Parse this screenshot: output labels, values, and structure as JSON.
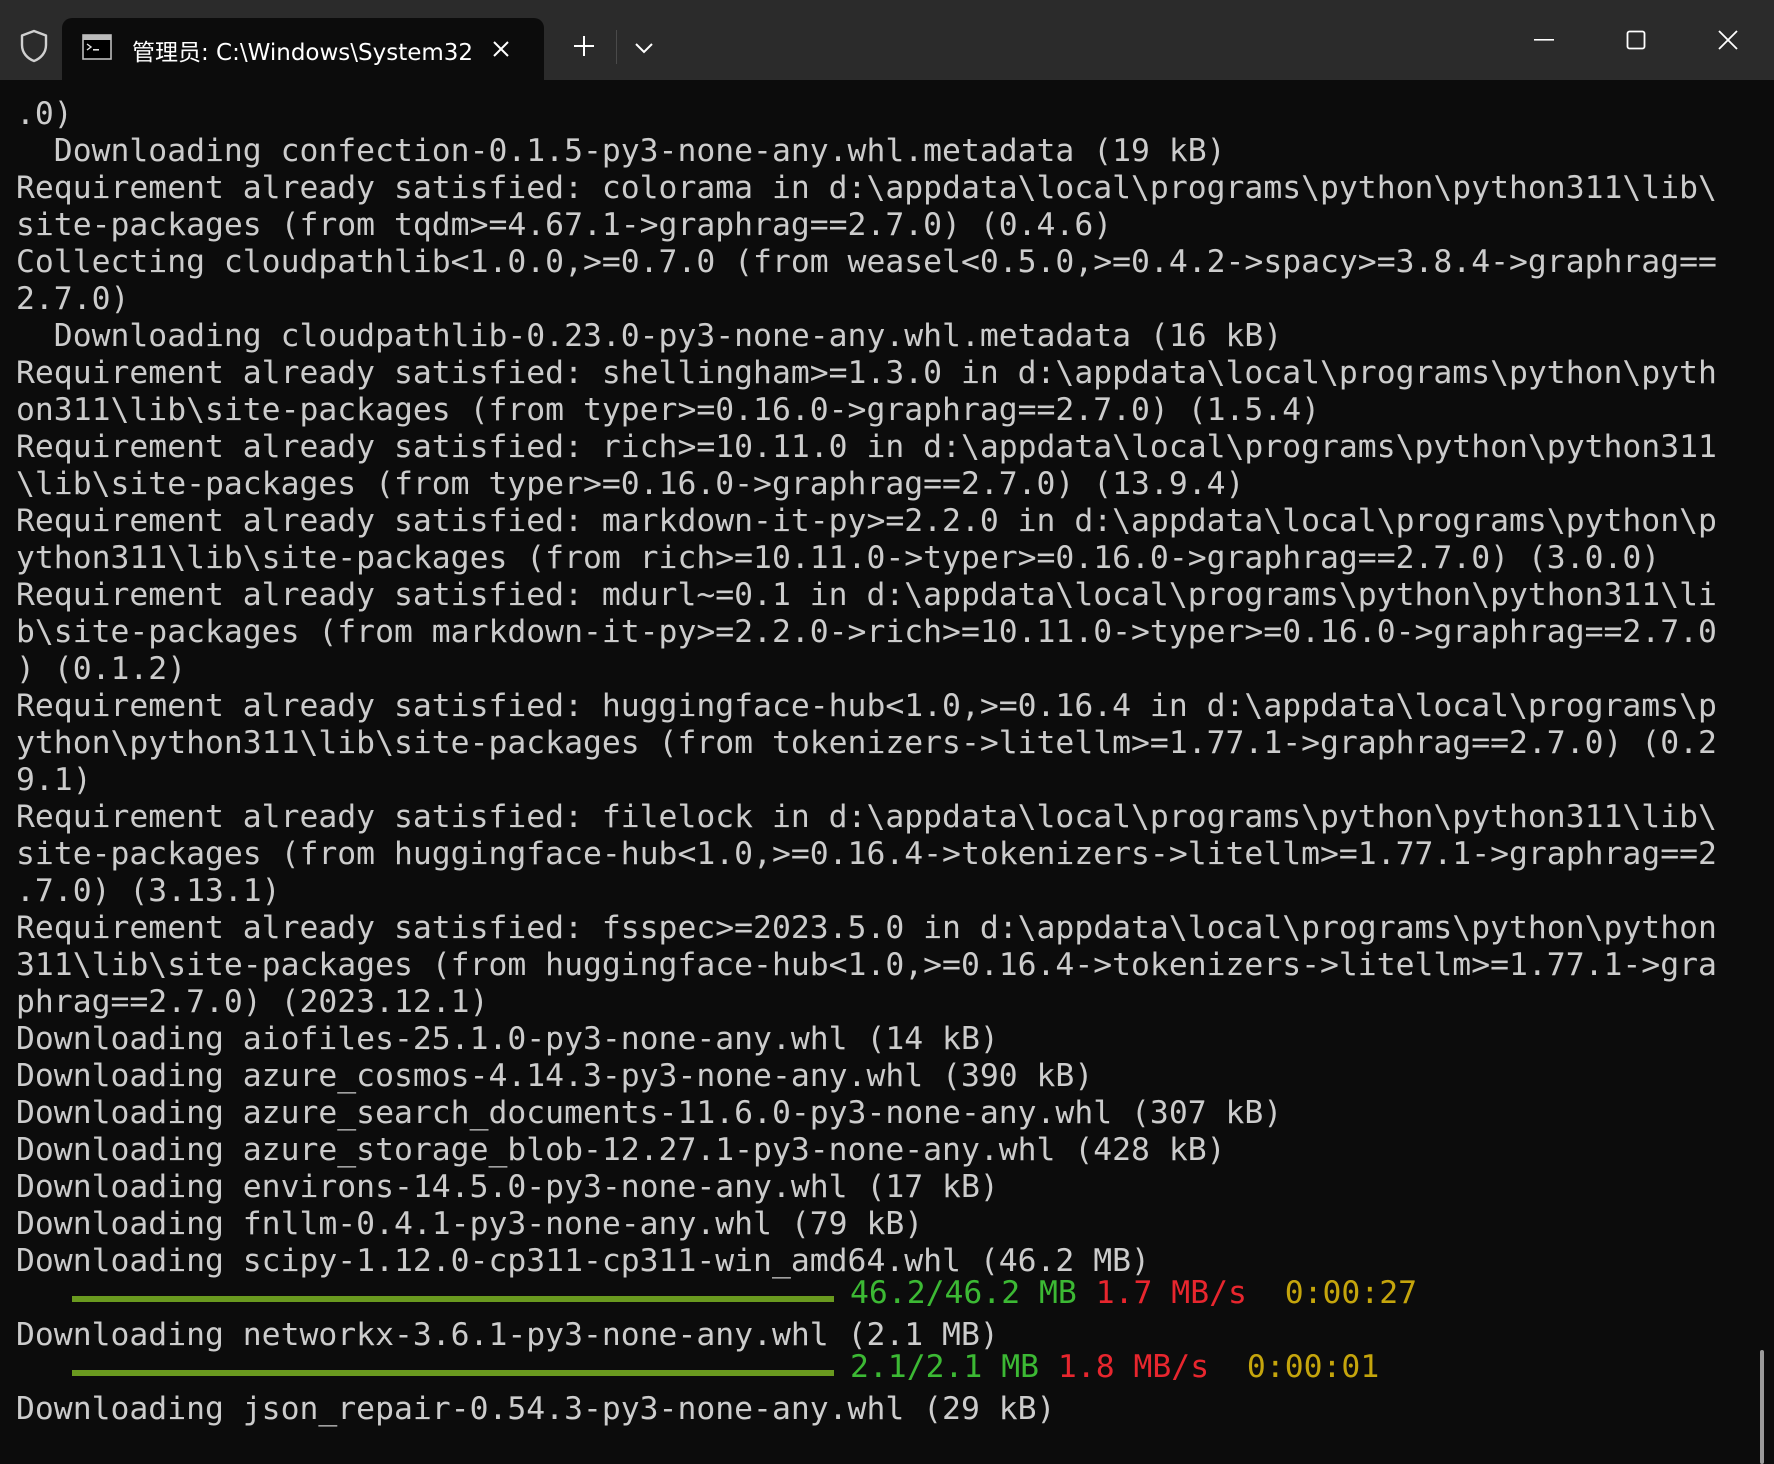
{
  "window": {
    "tab_title": "管理员: C:\\Windows\\System32",
    "icons": {
      "shield": "shield-icon",
      "terminal": "terminal-icon",
      "tab_close": "close-icon",
      "new_tab": "plus-icon",
      "dropdown": "chevron-down-icon",
      "minimize": "minimize-icon",
      "maximize": "maximize-icon",
      "close": "close-icon"
    }
  },
  "colors": {
    "background": "#0c0c0c",
    "titlebar": "#2b2b2b",
    "text": "#cccccc",
    "progress_bar": "#6a9a1f",
    "green": "#3cb934",
    "red": "#e8262e",
    "yellow": "#c5a50c"
  },
  "terminal": {
    "lines": [
      ".0)",
      "  Downloading confection-0.1.5-py3-none-any.whl.metadata (19 kB)",
      "Requirement already satisfied: colorama in d:\\appdata\\local\\programs\\python\\python311\\lib\\",
      "site-packages (from tqdm>=4.67.1->graphrag==2.7.0) (0.4.6)",
      "Collecting cloudpathlib<1.0.0,>=0.7.0 (from weasel<0.5.0,>=0.4.2->spacy>=3.8.4->graphrag==",
      "2.7.0)",
      "  Downloading cloudpathlib-0.23.0-py3-none-any.whl.metadata (16 kB)",
      "Requirement already satisfied: shellingham>=1.3.0 in d:\\appdata\\local\\programs\\python\\pyth",
      "on311\\lib\\site-packages (from typer>=0.16.0->graphrag==2.7.0) (1.5.4)",
      "Requirement already satisfied: rich>=10.11.0 in d:\\appdata\\local\\programs\\python\\python311",
      "\\lib\\site-packages (from typer>=0.16.0->graphrag==2.7.0) (13.9.4)",
      "Requirement already satisfied: markdown-it-py>=2.2.0 in d:\\appdata\\local\\programs\\python\\p",
      "ython311\\lib\\site-packages (from rich>=10.11.0->typer>=0.16.0->graphrag==2.7.0) (3.0.0)",
      "Requirement already satisfied: mdurl~=0.1 in d:\\appdata\\local\\programs\\python\\python311\\li",
      "b\\site-packages (from markdown-it-py>=2.2.0->rich>=10.11.0->typer>=0.16.0->graphrag==2.7.0",
      ") (0.1.2)",
      "Requirement already satisfied: huggingface-hub<1.0,>=0.16.4 in d:\\appdata\\local\\programs\\p",
      "ython\\python311\\lib\\site-packages (from tokenizers->litellm>=1.77.1->graphrag==2.7.0) (0.2",
      "9.1)",
      "Requirement already satisfied: filelock in d:\\appdata\\local\\programs\\python\\python311\\lib\\",
      "site-packages (from huggingface-hub<1.0,>=0.16.4->tokenizers->litellm>=1.77.1->graphrag==2",
      ".7.0) (3.13.1)",
      "Requirement already satisfied: fsspec>=2023.5.0 in d:\\appdata\\local\\programs\\python\\python",
      "311\\lib\\site-packages (from huggingface-hub<1.0,>=0.16.4->tokenizers->litellm>=1.77.1->gra",
      "phrag==2.7.0) (2023.12.1)",
      "Downloading aiofiles-25.1.0-py3-none-any.whl (14 kB)",
      "Downloading azure_cosmos-4.14.3-py3-none-any.whl (390 kB)",
      "Downloading azure_search_documents-11.6.0-py3-none-any.whl (307 kB)",
      "Downloading azure_storage_blob-12.27.1-py3-none-any.whl (428 kB)",
      "Downloading environs-14.5.0-py3-none-any.whl (17 kB)",
      "Downloading fnllm-0.4.1-py3-none-any.whl (79 kB)",
      "Downloading scipy-1.12.0-cp311-cp311-win_amd64.whl (46.2 MB)",
      "",
      "Downloading networkx-3.6.1-py3-none-any.whl (2.1 MB)",
      "",
      "Downloading json_repair-0.54.3-py3-none-any.whl (29 kB)"
    ],
    "progress": [
      {
        "size": "46.2/46.2 MB",
        "speed": "1.7 MB/s",
        "eta": "0:00:27",
        "fraction": 1.0
      },
      {
        "size": "2.1/2.1 MB",
        "speed": "1.8 MB/s",
        "eta": "0:00:01",
        "fraction": 1.0
      }
    ]
  }
}
